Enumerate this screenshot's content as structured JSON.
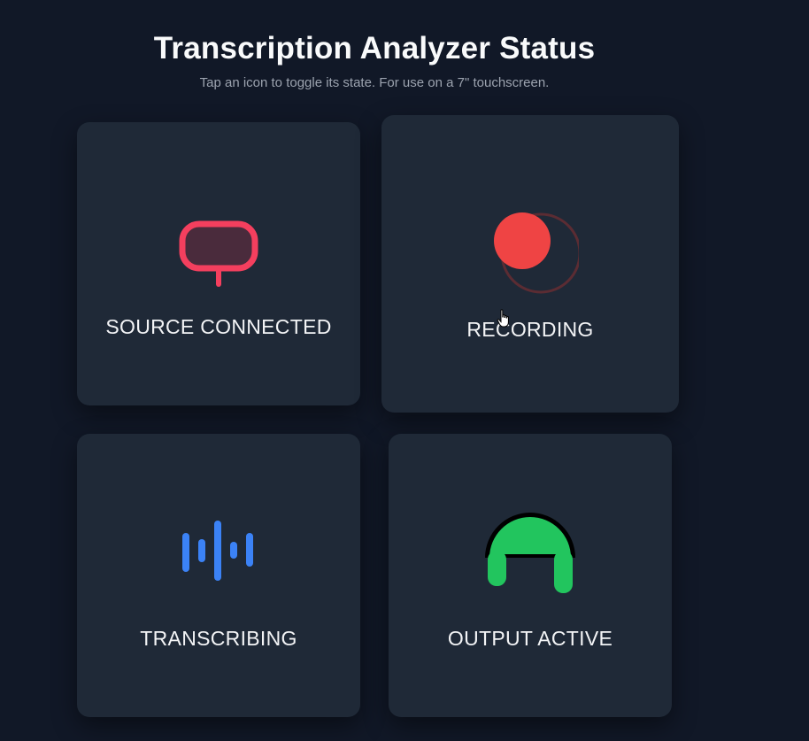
{
  "header": {
    "title": "Transcription Analyzer Status",
    "subtitle": "Tap an icon to toggle its state. For use on a 7\" touchscreen."
  },
  "cards": [
    {
      "id": "source",
      "label": "SOURCE CONNECTED",
      "icon": "source-connector-icon",
      "color": "#f43f5e"
    },
    {
      "id": "recording",
      "label": "RECORDING",
      "icon": "record-dot-icon",
      "color": "#ef4444"
    },
    {
      "id": "transcribing",
      "label": "TRANSCRIBING",
      "icon": "soundwave-icon",
      "color": "#3b82f6"
    },
    {
      "id": "output",
      "label": "OUTPUT ACTIVE",
      "icon": "headphones-icon",
      "color": "#22c55e"
    }
  ],
  "colors": {
    "background": "#111827",
    "card": "#1f2937",
    "title": "#f9fafb",
    "subtitle": "#9ca3af"
  }
}
